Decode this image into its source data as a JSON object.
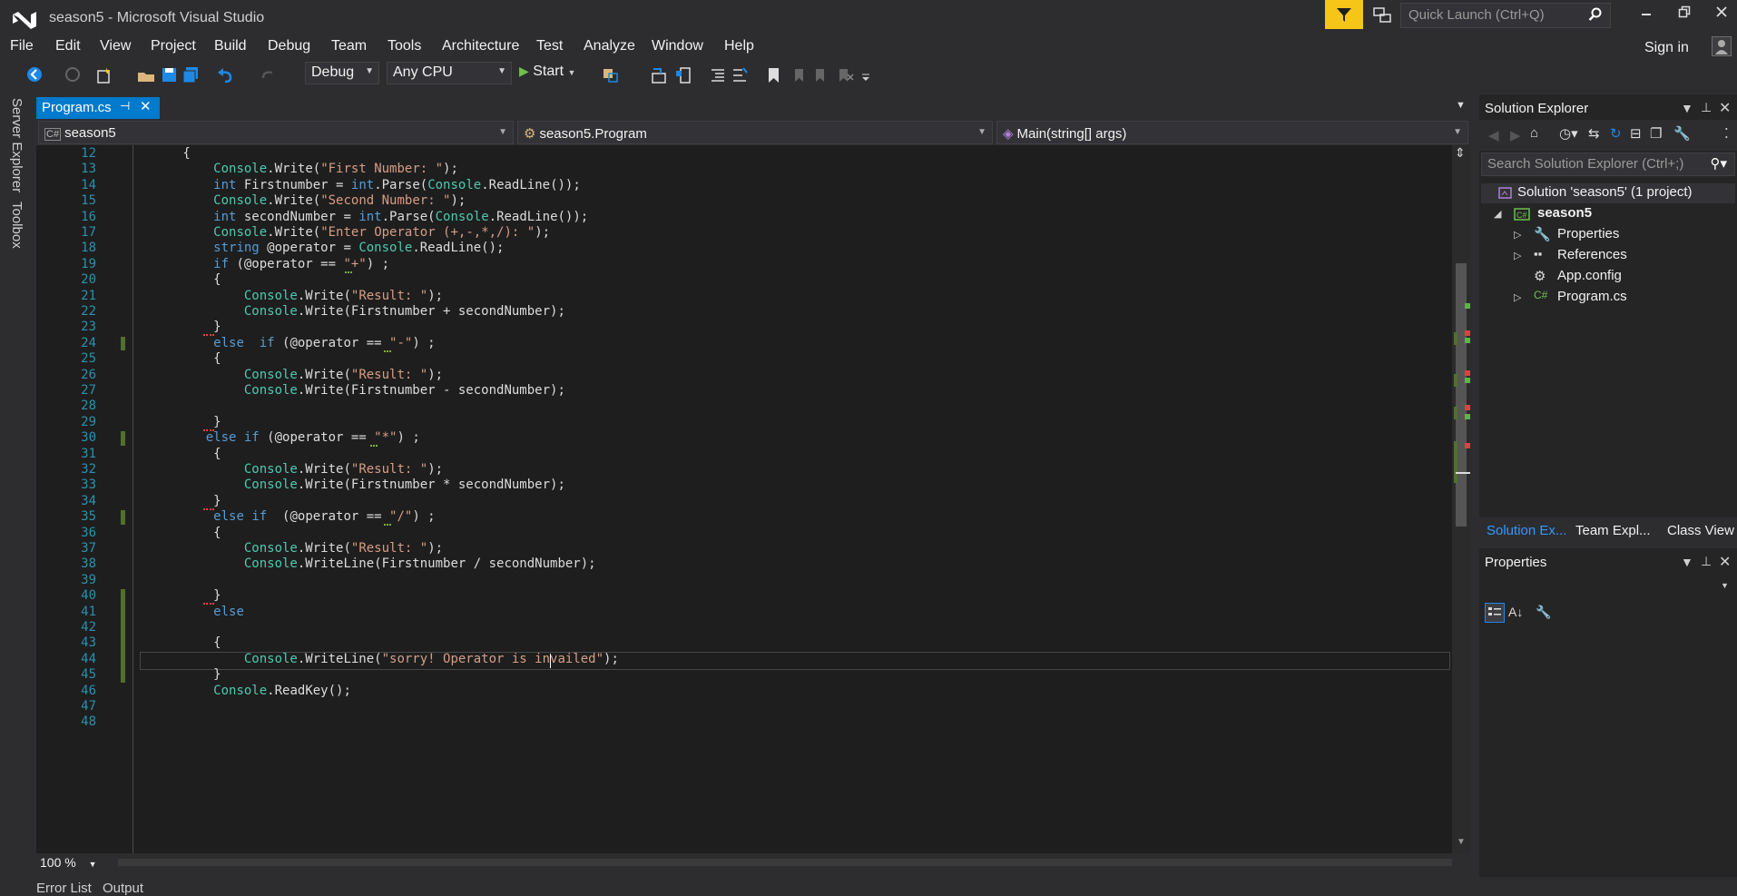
{
  "window": {
    "title": "season5 - Microsoft Visual Studio"
  },
  "quick_launch": {
    "placeholder": "Quick Launch (Ctrl+Q)"
  },
  "menu": [
    "File",
    "Edit",
    "View",
    "Project",
    "Build",
    "Debug",
    "Team",
    "Tools",
    "Architecture",
    "Test",
    "Analyze",
    "Window",
    "Help"
  ],
  "account": {
    "signin": "Sign in"
  },
  "toolbar": {
    "config": "Debug",
    "platform": "Any CPU",
    "start": "Start"
  },
  "side_tabs": [
    "Server Explorer",
    "Toolbox"
  ],
  "document_tab": {
    "label": "Program.cs"
  },
  "nav": {
    "project": "season5",
    "class": "season5.Program",
    "member": "Main(string[] args)"
  },
  "editor": {
    "zoom": "100 %",
    "line_numbers": [
      "12",
      "13",
      "14",
      "15",
      "16",
      "17",
      "18",
      "19",
      "20",
      "21",
      "22",
      "23",
      "24",
      "25",
      "26",
      "27",
      "28",
      "29",
      "30",
      "31",
      "32",
      "33",
      "34",
      "35",
      "36",
      "37",
      "38",
      "39",
      "40",
      "41",
      "42",
      "43",
      "44",
      "45",
      "46",
      "47",
      "48"
    ],
    "lines": [
      [
        [
          "t",
          "        {"
        ]
      ],
      [
        [
          "t",
          "            "
        ],
        [
          "ty",
          "Console"
        ],
        [
          "t",
          ".Write("
        ],
        [
          "st",
          "\"First Number: \""
        ],
        [
          "t",
          ");"
        ]
      ],
      [
        [
          "t",
          "            "
        ],
        [
          "kw",
          "int"
        ],
        [
          "t",
          " Firstnumber = "
        ],
        [
          "kw",
          "int"
        ],
        [
          "t",
          ".Parse("
        ],
        [
          "ty",
          "Console"
        ],
        [
          "t",
          ".ReadLine());"
        ]
      ],
      [
        [
          "t",
          "            "
        ],
        [
          "ty",
          "Console"
        ],
        [
          "t",
          ".Write("
        ],
        [
          "st",
          "\"Second Number: \""
        ],
        [
          "t",
          ");"
        ]
      ],
      [
        [
          "t",
          "            "
        ],
        [
          "kw",
          "int"
        ],
        [
          "t",
          " secondNumber = "
        ],
        [
          "kw",
          "int"
        ],
        [
          "t",
          ".Parse("
        ],
        [
          "ty",
          "Console"
        ],
        [
          "t",
          ".ReadLine());"
        ]
      ],
      [
        [
          "t",
          "            "
        ],
        [
          "ty",
          "Console"
        ],
        [
          "t",
          ".Write("
        ],
        [
          "st",
          "\"Enter Operator (+,-,*,/): \""
        ],
        [
          "t",
          ");"
        ]
      ],
      [
        [
          "t",
          "            "
        ],
        [
          "kw",
          "string"
        ],
        [
          "t",
          " @operator = "
        ],
        [
          "ty",
          "Console"
        ],
        [
          "t",
          ".ReadLine();"
        ]
      ],
      [
        [
          "t",
          "            "
        ],
        [
          "kw",
          "if"
        ],
        [
          "t",
          " (@operator == "
        ],
        [
          "st",
          "\"+\""
        ],
        [
          "t",
          ") ;"
        ]
      ],
      [
        [
          "t",
          "            {"
        ]
      ],
      [
        [
          "t",
          "                "
        ],
        [
          "ty",
          "Console"
        ],
        [
          "t",
          ".Write("
        ],
        [
          "st",
          "\"Result: \""
        ],
        [
          "t",
          ");"
        ]
      ],
      [
        [
          "t",
          "                "
        ],
        [
          "ty",
          "Console"
        ],
        [
          "t",
          ".Write(Firstnumber + secondNumber);"
        ]
      ],
      [
        [
          "t",
          "            }"
        ]
      ],
      [
        [
          "t",
          "            "
        ],
        [
          "kw",
          "else"
        ],
        [
          "t",
          "  "
        ],
        [
          "kw",
          "if"
        ],
        [
          "t",
          " (@operator == "
        ],
        [
          "st",
          "\"-\""
        ],
        [
          "t",
          ") ;"
        ]
      ],
      [
        [
          "t",
          "            {"
        ]
      ],
      [
        [
          "t",
          "                "
        ],
        [
          "ty",
          "Console"
        ],
        [
          "t",
          ".Write("
        ],
        [
          "st",
          "\"Result: \""
        ],
        [
          "t",
          ");"
        ]
      ],
      [
        [
          "t",
          "                "
        ],
        [
          "ty",
          "Console"
        ],
        [
          "t",
          ".Write(Firstnumber - secondNumber);"
        ]
      ],
      [
        [
          "t",
          ""
        ]
      ],
      [
        [
          "t",
          "            }"
        ]
      ],
      [
        [
          "t",
          "           "
        ],
        [
          "kw",
          "else"
        ],
        [
          "t",
          " "
        ],
        [
          "kw",
          "if"
        ],
        [
          "t",
          " (@operator == "
        ],
        [
          "st",
          "\"*\""
        ],
        [
          "t",
          ") ;"
        ]
      ],
      [
        [
          "t",
          "            {"
        ]
      ],
      [
        [
          "t",
          "                "
        ],
        [
          "ty",
          "Console"
        ],
        [
          "t",
          ".Write("
        ],
        [
          "st",
          "\"Result: \""
        ],
        [
          "t",
          ");"
        ]
      ],
      [
        [
          "t",
          "                "
        ],
        [
          "ty",
          "Console"
        ],
        [
          "t",
          ".Write(Firstnumber * secondNumber);"
        ]
      ],
      [
        [
          "t",
          "            }"
        ]
      ],
      [
        [
          "t",
          "            "
        ],
        [
          "kw",
          "else"
        ],
        [
          "t",
          " "
        ],
        [
          "kw",
          "if"
        ],
        [
          "t",
          "  (@operator == "
        ],
        [
          "st",
          "\"/\""
        ],
        [
          "t",
          ") ;"
        ]
      ],
      [
        [
          "t",
          "            {"
        ]
      ],
      [
        [
          "t",
          "                "
        ],
        [
          "ty",
          "Console"
        ],
        [
          "t",
          ".Write("
        ],
        [
          "st",
          "\"Result: \""
        ],
        [
          "t",
          ");"
        ]
      ],
      [
        [
          "t",
          "                "
        ],
        [
          "ty",
          "Console"
        ],
        [
          "t",
          ".WriteLine(Firstnumber / secondNumber);"
        ]
      ],
      [
        [
          "t",
          ""
        ]
      ],
      [
        [
          "t",
          "            }"
        ]
      ],
      [
        [
          "t",
          "            "
        ],
        [
          "kw",
          "else"
        ]
      ],
      [
        [
          "t",
          ""
        ]
      ],
      [
        [
          "t",
          "            {"
        ]
      ],
      [
        [
          "t",
          "                "
        ],
        [
          "ty",
          "Console"
        ],
        [
          "t",
          ".WriteLine("
        ],
        [
          "st",
          "\"sorry! Operator is invailed\""
        ],
        [
          "t",
          ");"
        ]
      ],
      [
        [
          "t",
          "            }"
        ]
      ],
      [
        [
          "t",
          "            "
        ],
        [
          "ty",
          "Console"
        ],
        [
          "t",
          ".ReadKey();"
        ]
      ],
      [
        [
          "t",
          ""
        ]
      ],
      [
        [
          "t",
          ""
        ]
      ]
    ]
  },
  "solution_explorer": {
    "title": "Solution Explorer",
    "search_placeholder": "Search Solution Explorer (Ctrl+;)",
    "solution": "Solution 'season5' (1 project)",
    "project": "season5",
    "items": [
      "Properties",
      "References",
      "App.config",
      "Program.cs"
    ],
    "tabs": [
      "Solution Ex...",
      "Team Expl...",
      "Class View"
    ]
  },
  "properties": {
    "title": "Properties"
  },
  "bottom_tabs": [
    "Error List",
    "Output"
  ],
  "colors": {
    "accent": "#007acc",
    "filter": "#f5c518",
    "change_bar": "#52702c",
    "line_number": "#2b91af"
  }
}
